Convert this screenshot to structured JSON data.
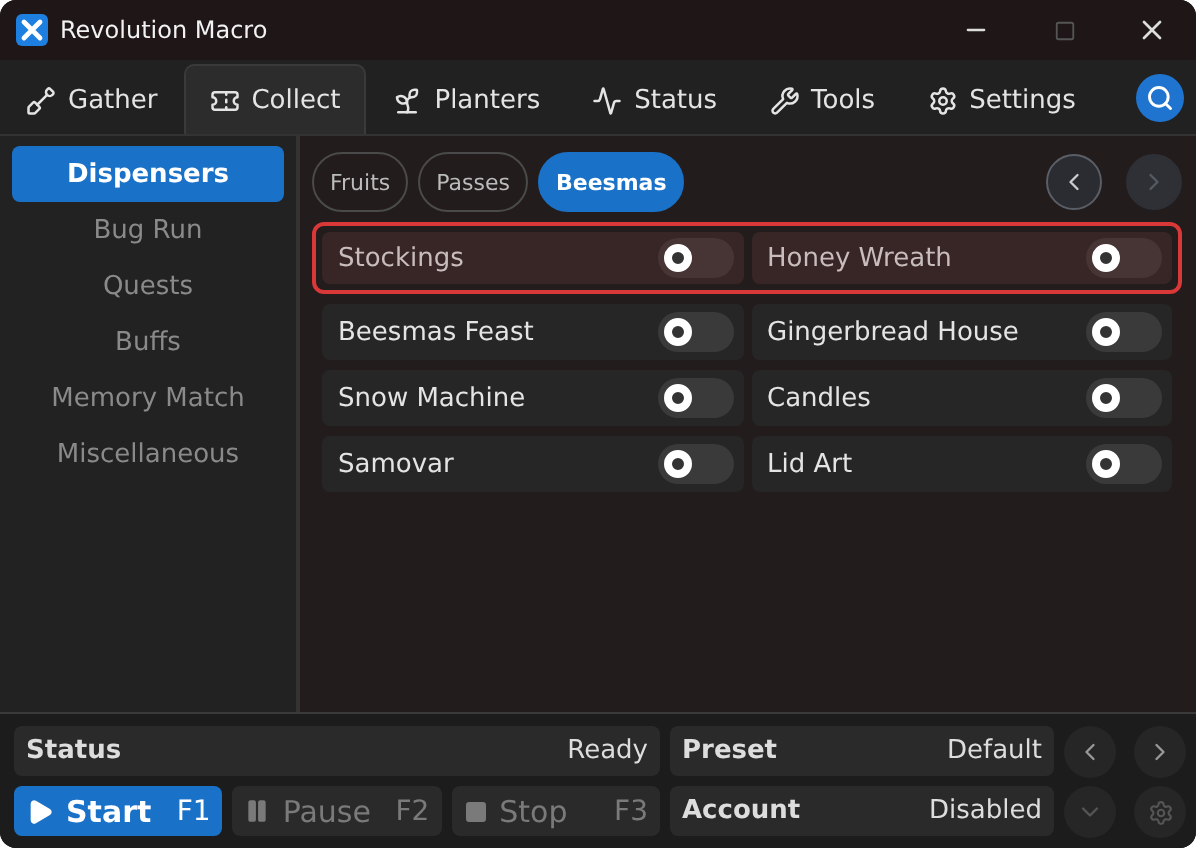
{
  "window": {
    "title": "Revolution Macro"
  },
  "tabs": [
    {
      "label": "Gather",
      "selected": false
    },
    {
      "label": "Collect",
      "selected": true
    },
    {
      "label": "Planters",
      "selected": false
    },
    {
      "label": "Status",
      "selected": false
    },
    {
      "label": "Tools",
      "selected": false
    },
    {
      "label": "Settings",
      "selected": false
    }
  ],
  "sidebar": {
    "items": [
      {
        "label": "Dispensers",
        "selected": true
      },
      {
        "label": "Bug Run",
        "selected": false
      },
      {
        "label": "Quests",
        "selected": false
      },
      {
        "label": "Buffs",
        "selected": false
      },
      {
        "label": "Memory Match",
        "selected": false
      },
      {
        "label": "Miscellaneous",
        "selected": false
      }
    ]
  },
  "chips": [
    {
      "label": "Fruits",
      "selected": false
    },
    {
      "label": "Passes",
      "selected": false
    },
    {
      "label": "Beesmas",
      "selected": true
    }
  ],
  "pager": {
    "prev_disabled": false,
    "next_disabled": true
  },
  "rows": [
    {
      "highlighted": true,
      "items": [
        {
          "label": "Stockings",
          "on": false
        },
        {
          "label": "Honey Wreath",
          "on": false
        }
      ]
    },
    {
      "highlighted": false,
      "items": [
        {
          "label": "Beesmas Feast",
          "on": false
        },
        {
          "label": "Gingerbread House",
          "on": false
        }
      ]
    },
    {
      "highlighted": false,
      "items": [
        {
          "label": "Snow Machine",
          "on": false
        },
        {
          "label": "Candles",
          "on": false
        }
      ]
    },
    {
      "highlighted": false,
      "items": [
        {
          "label": "Samovar",
          "on": false
        },
        {
          "label": "Lid Art",
          "on": false
        }
      ]
    }
  ],
  "status": {
    "label": "Status",
    "value": "Ready"
  },
  "preset": {
    "label": "Preset",
    "value": "Default"
  },
  "account": {
    "label": "Account",
    "value": "Disabled"
  },
  "controls": [
    {
      "label": "Start",
      "key": "F1",
      "disabled": false
    },
    {
      "label": "Pause",
      "key": "F2",
      "disabled": true
    },
    {
      "label": "Stop",
      "key": "F3",
      "disabled": true
    }
  ]
}
